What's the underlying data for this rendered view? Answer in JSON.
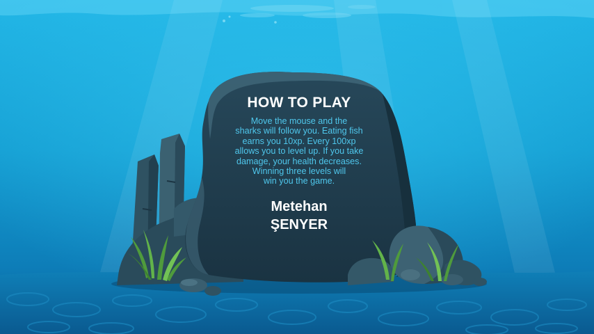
{
  "instructions": {
    "title": "HOW TO PLAY",
    "body": "Move the mouse and the\nsharks will follow you. Eating fish\nearns you 10xp. Every 100xp\nallows you to level up. If you take\ndamage, your health decreases.\nWinning three levels will\nwin you the game."
  },
  "credits": {
    "author": "Metehan\nŞENYER"
  },
  "colors": {
    "water_top": "#1bb3e3",
    "water_mid": "#139ccf",
    "water_deep": "#0a5f95",
    "stone_dark": "#1f3c4b",
    "stone_light": "#3d5f70",
    "body_text": "#4fc7ec",
    "heading_text": "#ffffff"
  }
}
